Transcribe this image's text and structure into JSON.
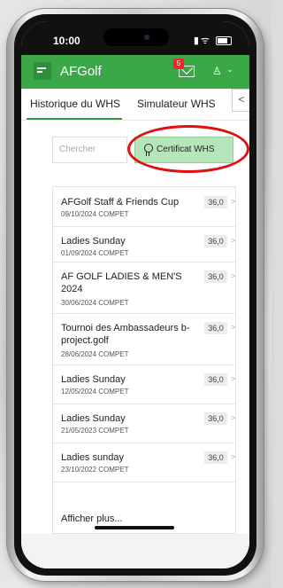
{
  "status_bar": {
    "time": "10:00"
  },
  "app_bar": {
    "title": "AFGolf",
    "notification_count": "5",
    "icons": [
      "menu-icon",
      "mail-icon",
      "user-icon",
      "chevron-down-icon"
    ]
  },
  "tabs": [
    {
      "label": "Historique du WHS",
      "active": true
    },
    {
      "label": "Simulateur WHS",
      "active": false
    }
  ],
  "collapse_label": "<",
  "search": {
    "placeholder": "Chercher"
  },
  "certificate_button": {
    "label": "Certificat WHS",
    "icon": "ribbon-icon"
  },
  "competitions": [
    {
      "title": "AFGolf Staff & Friends Cup",
      "date": "09/10/2024 COMPET",
      "score": "36,0"
    },
    {
      "title": "Ladies Sunday",
      "date": "01/09/2024 COMPET",
      "score": "36,0"
    },
    {
      "title": "AF GOLF LADIES & MEN'S 2024",
      "date": "30/06/2024 COMPET",
      "score": "36,0"
    },
    {
      "title": "Tournoi des Ambassadeurs b-project.golf",
      "date": "28/06/2024 COMPET",
      "score": "36,0"
    },
    {
      "title": "Ladies Sunday",
      "date": "12/05/2024 COMPET",
      "score": "36,0"
    },
    {
      "title": "Ladies Sunday",
      "date": "21/05/2023 COMPET",
      "score": "36,0"
    },
    {
      "title": "Ladies sunday",
      "date": "23/10/2022 COMPET",
      "score": "36,0"
    }
  ],
  "show_more_label": "Afficher plus...",
  "arrow_glyph": ">",
  "colors": {
    "primary": "#3aa846",
    "certificate_bg": "#b5e6b9",
    "highlight": "#e01010",
    "badge": "#e32b2b"
  }
}
